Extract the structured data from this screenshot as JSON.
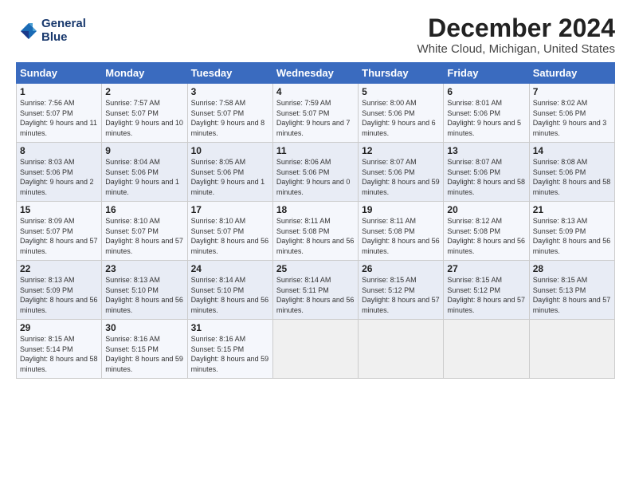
{
  "logo": {
    "line1": "General",
    "line2": "Blue"
  },
  "title": "December 2024",
  "subtitle": "White Cloud, Michigan, United States",
  "days_header": [
    "Sunday",
    "Monday",
    "Tuesday",
    "Wednesday",
    "Thursday",
    "Friday",
    "Saturday"
  ],
  "weeks": [
    [
      {
        "day": "1",
        "sunrise": "Sunrise: 7:56 AM",
        "sunset": "Sunset: 5:07 PM",
        "daylight": "Daylight: 9 hours and 11 minutes."
      },
      {
        "day": "2",
        "sunrise": "Sunrise: 7:57 AM",
        "sunset": "Sunset: 5:07 PM",
        "daylight": "Daylight: 9 hours and 10 minutes."
      },
      {
        "day": "3",
        "sunrise": "Sunrise: 7:58 AM",
        "sunset": "Sunset: 5:07 PM",
        "daylight": "Daylight: 9 hours and 8 minutes."
      },
      {
        "day": "4",
        "sunrise": "Sunrise: 7:59 AM",
        "sunset": "Sunset: 5:07 PM",
        "daylight": "Daylight: 9 hours and 7 minutes."
      },
      {
        "day": "5",
        "sunrise": "Sunrise: 8:00 AM",
        "sunset": "Sunset: 5:06 PM",
        "daylight": "Daylight: 9 hours and 6 minutes."
      },
      {
        "day": "6",
        "sunrise": "Sunrise: 8:01 AM",
        "sunset": "Sunset: 5:06 PM",
        "daylight": "Daylight: 9 hours and 5 minutes."
      },
      {
        "day": "7",
        "sunrise": "Sunrise: 8:02 AM",
        "sunset": "Sunset: 5:06 PM",
        "daylight": "Daylight: 9 hours and 3 minutes."
      }
    ],
    [
      {
        "day": "8",
        "sunrise": "Sunrise: 8:03 AM",
        "sunset": "Sunset: 5:06 PM",
        "daylight": "Daylight: 9 hours and 2 minutes."
      },
      {
        "day": "9",
        "sunrise": "Sunrise: 8:04 AM",
        "sunset": "Sunset: 5:06 PM",
        "daylight": "Daylight: 9 hours and 1 minute."
      },
      {
        "day": "10",
        "sunrise": "Sunrise: 8:05 AM",
        "sunset": "Sunset: 5:06 PM",
        "daylight": "Daylight: 9 hours and 1 minute."
      },
      {
        "day": "11",
        "sunrise": "Sunrise: 8:06 AM",
        "sunset": "Sunset: 5:06 PM",
        "daylight": "Daylight: 9 hours and 0 minutes."
      },
      {
        "day": "12",
        "sunrise": "Sunrise: 8:07 AM",
        "sunset": "Sunset: 5:06 PM",
        "daylight": "Daylight: 8 hours and 59 minutes."
      },
      {
        "day": "13",
        "sunrise": "Sunrise: 8:07 AM",
        "sunset": "Sunset: 5:06 PM",
        "daylight": "Daylight: 8 hours and 58 minutes."
      },
      {
        "day": "14",
        "sunrise": "Sunrise: 8:08 AM",
        "sunset": "Sunset: 5:06 PM",
        "daylight": "Daylight: 8 hours and 58 minutes."
      }
    ],
    [
      {
        "day": "15",
        "sunrise": "Sunrise: 8:09 AM",
        "sunset": "Sunset: 5:07 PM",
        "daylight": "Daylight: 8 hours and 57 minutes."
      },
      {
        "day": "16",
        "sunrise": "Sunrise: 8:10 AM",
        "sunset": "Sunset: 5:07 PM",
        "daylight": "Daylight: 8 hours and 57 minutes."
      },
      {
        "day": "17",
        "sunrise": "Sunrise: 8:10 AM",
        "sunset": "Sunset: 5:07 PM",
        "daylight": "Daylight: 8 hours and 56 minutes."
      },
      {
        "day": "18",
        "sunrise": "Sunrise: 8:11 AM",
        "sunset": "Sunset: 5:08 PM",
        "daylight": "Daylight: 8 hours and 56 minutes."
      },
      {
        "day": "19",
        "sunrise": "Sunrise: 8:11 AM",
        "sunset": "Sunset: 5:08 PM",
        "daylight": "Daylight: 8 hours and 56 minutes."
      },
      {
        "day": "20",
        "sunrise": "Sunrise: 8:12 AM",
        "sunset": "Sunset: 5:08 PM",
        "daylight": "Daylight: 8 hours and 56 minutes."
      },
      {
        "day": "21",
        "sunrise": "Sunrise: 8:13 AM",
        "sunset": "Sunset: 5:09 PM",
        "daylight": "Daylight: 8 hours and 56 minutes."
      }
    ],
    [
      {
        "day": "22",
        "sunrise": "Sunrise: 8:13 AM",
        "sunset": "Sunset: 5:09 PM",
        "daylight": "Daylight: 8 hours and 56 minutes."
      },
      {
        "day": "23",
        "sunrise": "Sunrise: 8:13 AM",
        "sunset": "Sunset: 5:10 PM",
        "daylight": "Daylight: 8 hours and 56 minutes."
      },
      {
        "day": "24",
        "sunrise": "Sunrise: 8:14 AM",
        "sunset": "Sunset: 5:10 PM",
        "daylight": "Daylight: 8 hours and 56 minutes."
      },
      {
        "day": "25",
        "sunrise": "Sunrise: 8:14 AM",
        "sunset": "Sunset: 5:11 PM",
        "daylight": "Daylight: 8 hours and 56 minutes."
      },
      {
        "day": "26",
        "sunrise": "Sunrise: 8:15 AM",
        "sunset": "Sunset: 5:12 PM",
        "daylight": "Daylight: 8 hours and 57 minutes."
      },
      {
        "day": "27",
        "sunrise": "Sunrise: 8:15 AM",
        "sunset": "Sunset: 5:12 PM",
        "daylight": "Daylight: 8 hours and 57 minutes."
      },
      {
        "day": "28",
        "sunrise": "Sunrise: 8:15 AM",
        "sunset": "Sunset: 5:13 PM",
        "daylight": "Daylight: 8 hours and 57 minutes."
      }
    ],
    [
      {
        "day": "29",
        "sunrise": "Sunrise: 8:15 AM",
        "sunset": "Sunset: 5:14 PM",
        "daylight": "Daylight: 8 hours and 58 minutes."
      },
      {
        "day": "30",
        "sunrise": "Sunrise: 8:16 AM",
        "sunset": "Sunset: 5:15 PM",
        "daylight": "Daylight: 8 hours and 59 minutes."
      },
      {
        "day": "31",
        "sunrise": "Sunrise: 8:16 AM",
        "sunset": "Sunset: 5:15 PM",
        "daylight": "Daylight: 8 hours and 59 minutes."
      },
      null,
      null,
      null,
      null
    ]
  ],
  "colors": {
    "header_bg": "#3a6bbf",
    "header_text": "#ffffff",
    "odd_row": "#f5f7fc",
    "even_row": "#e8ecf5"
  }
}
